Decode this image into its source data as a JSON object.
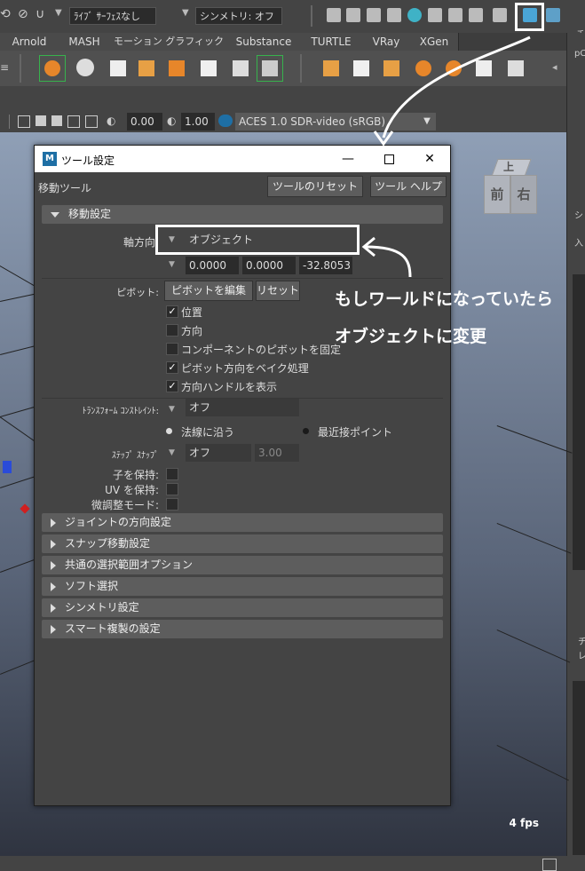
{
  "toolbar": {
    "live_surface": "ﾗｲﾌﾞ ｻｰﾌｪｽなし",
    "symmetry": "シンメトリ: オフ"
  },
  "shelf_tabs": [
    "Arnold",
    "MASH",
    "モーション グラフィックス",
    "Substance",
    "TURTLE",
    "VRay",
    "XGen"
  ],
  "viewport_toolbar": {
    "value1": "0.00",
    "value2": "1.00",
    "colorspace": "ACES 1.0 SDR-video (sRGB)"
  },
  "viewport": {
    "fps": "4 fps",
    "viewcube": {
      "top": "上",
      "front": "前",
      "right": "右"
    }
  },
  "dialog": {
    "title": "ツール設定",
    "tool_name": "移動ツール",
    "reset_button": "ツールのリセット",
    "help_button": "ツール ヘルプ",
    "sections": {
      "move": "移動設定",
      "collapsed": [
        "ジョイントの方向設定",
        "スナップ移動設定",
        "共通の選択範囲オプション",
        "ソフト選択",
        "シンメトリ設定",
        "スマート複製の設定"
      ]
    },
    "axis_label": "軸方向",
    "axis_value": "オブジェクト",
    "axis_values": [
      "0.0000",
      "0.0000",
      "-32.8053"
    ],
    "pivot_label": "ピボット:",
    "pivot_edit": "ピボットを編集",
    "pivot_reset": "リセット",
    "checkboxes": [
      {
        "label": "位置",
        "checked": true
      },
      {
        "label": "方向",
        "checked": false
      },
      {
        "label": "コンポーネントのピボットを固定",
        "checked": false
      },
      {
        "label": "ピボット方向をベイク処理",
        "checked": true
      },
      {
        "label": "方向ハンドルを表示",
        "checked": true
      }
    ],
    "constraint_label": "ﾄﾗﾝｽﾌｫｰﾑ ｺﾝｽﾄﾚｲﾝﾄ:",
    "constraint_value": "オフ",
    "radio_edge": "法線に沿う",
    "radio_nearest": "最近接ポイント",
    "step_snap_label": "ｽﾃｯﾌﾟ ｽﾅｯﾌﾟ",
    "step_snap_value": "オフ",
    "step_snap_amount": "3.00",
    "keep_children": "子を保持:",
    "keep_uv": "UV を保持:",
    "fine_tune": "微調整モード:"
  },
  "annotation": {
    "line1": "もしワールドになっていたら",
    "line2": "オブジェクトに変更"
  },
  "colors": {
    "accent_green": "#37b24d",
    "highlight": "#ffffff"
  }
}
